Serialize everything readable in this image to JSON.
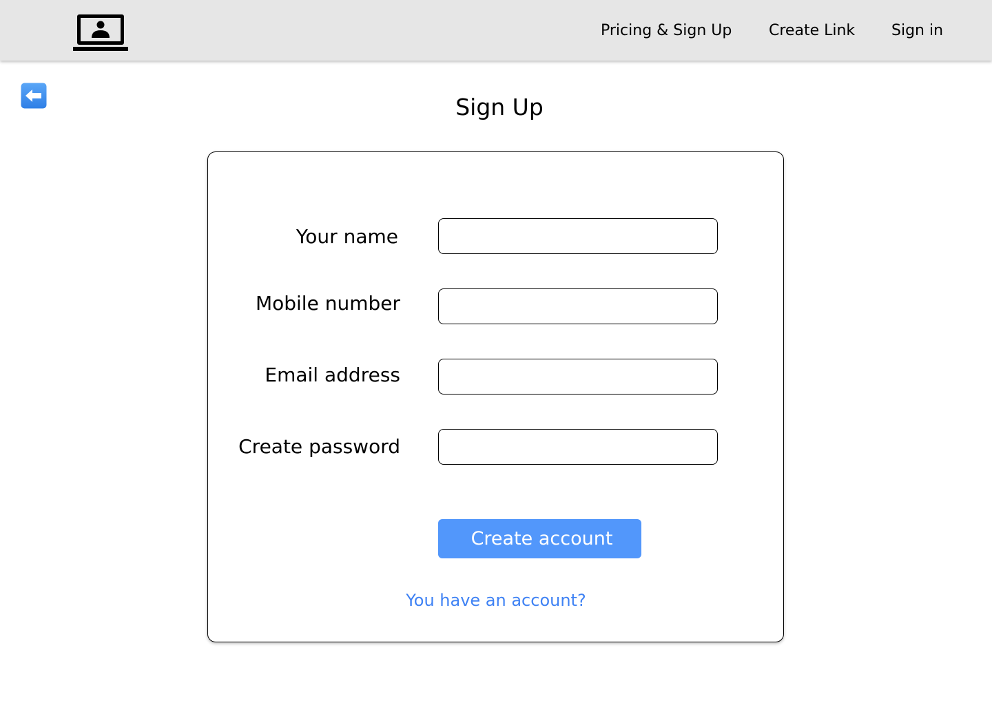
{
  "colors": {
    "header_bg": "#e6e6e6",
    "accent": "#5297fb",
    "link": "#3f82f4",
    "back_icon": "#3d8ef0"
  },
  "header": {
    "logo_icon": "laptop-user-icon",
    "nav": [
      {
        "label": "Pricing & Sign Up"
      },
      {
        "label": "Create Link"
      },
      {
        "label": "Sign in"
      }
    ]
  },
  "back_button": {
    "icon": "left-arrow-icon"
  },
  "page": {
    "title": "Sign Up"
  },
  "form": {
    "fields": [
      {
        "label": "Your name",
        "value": "",
        "placeholder": ""
      },
      {
        "label": "Mobile number",
        "value": "",
        "placeholder": ""
      },
      {
        "label": "Email address",
        "value": "",
        "placeholder": ""
      },
      {
        "label": "Create password",
        "value": "",
        "placeholder": ""
      }
    ],
    "submit_label": "Create account",
    "signin_link": "You have an account?"
  }
}
